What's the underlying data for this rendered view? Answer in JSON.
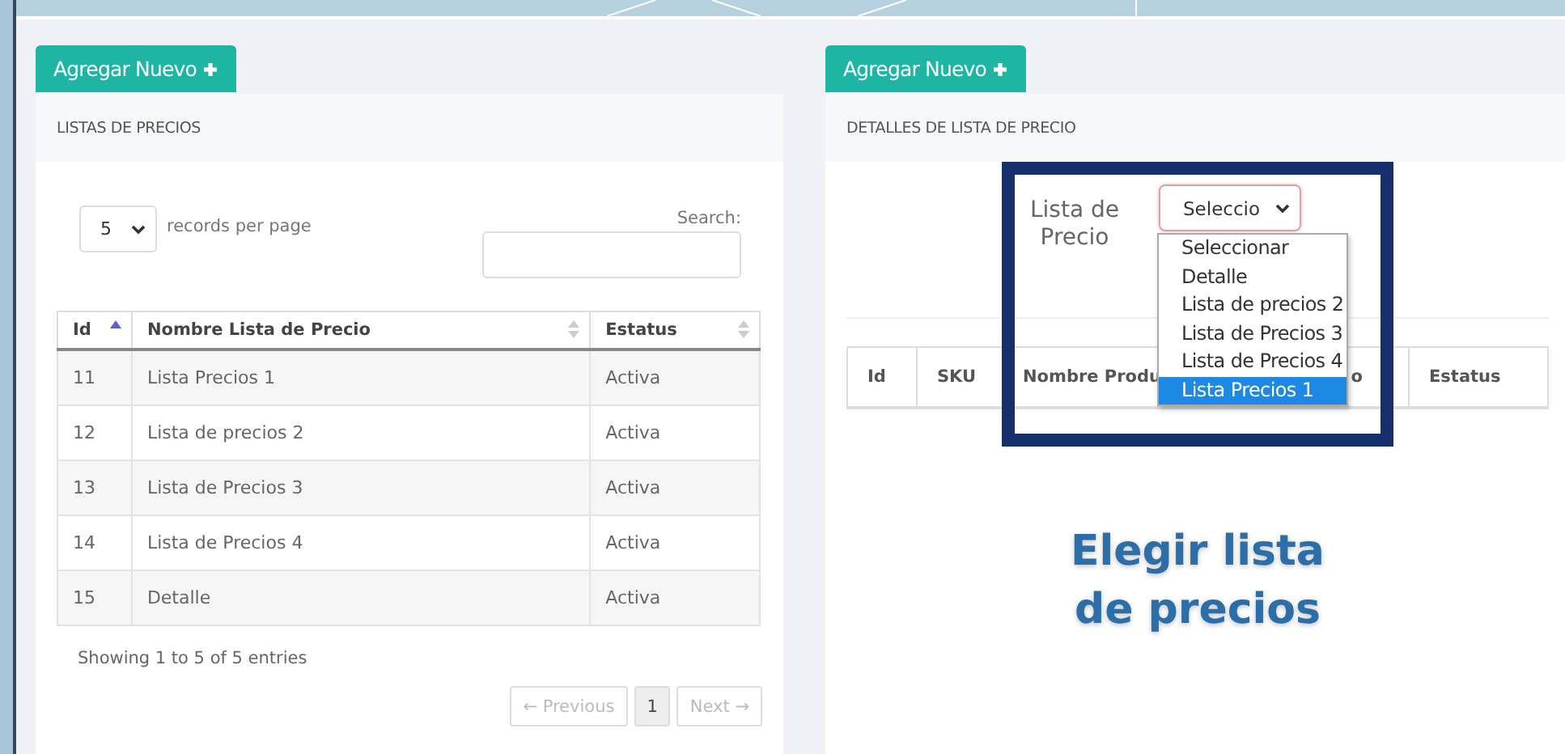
{
  "left_panel": {
    "add_button": "Agregar Nuevo",
    "title": "LISTAS DE PRECIOS",
    "page_size": "5",
    "page_size_label": "records per page",
    "search_label": "Search:",
    "columns": [
      {
        "label": "Id",
        "sorted": true
      },
      {
        "label": "Nombre Lista de Precio",
        "sorted": false
      },
      {
        "label": "Estatus",
        "sorted": false
      }
    ],
    "rows": [
      [
        "11",
        "Lista Precios 1",
        "Activa"
      ],
      [
        "12",
        "Lista de precios 2",
        "Activa"
      ],
      [
        "13",
        "Lista de Precios 3",
        "Activa"
      ],
      [
        "14",
        "Lista de Precios 4",
        "Activa"
      ],
      [
        "15",
        "Detalle",
        "Activa"
      ]
    ],
    "info": "Showing 1 to 5 of 5 entries",
    "pagination": [
      {
        "label": "← Previous",
        "selected": false,
        "disabled": true
      },
      {
        "label": "1",
        "selected": true,
        "disabled": false
      },
      {
        "label": "Next →",
        "selected": false,
        "disabled": true
      }
    ]
  },
  "right_panel": {
    "add_button": "Agregar Nuevo",
    "title": "DETALLES DE LISTA DE PRECIO",
    "filter_label": "Lista de Precio",
    "select_value": "Seleccio",
    "dropdown_options": [
      {
        "label": "Seleccionar",
        "selected": false
      },
      {
        "label": "Detalle",
        "selected": false
      },
      {
        "label": "Lista de precios 2",
        "selected": false
      },
      {
        "label": "Lista de Precios 3",
        "selected": false
      },
      {
        "label": "Lista de Precios 4",
        "selected": false
      },
      {
        "label": "Lista Precios 1",
        "selected": true
      }
    ],
    "columns": [
      "Id",
      "SKU",
      "Nombre Produ",
      "o",
      "Estatus"
    ]
  },
  "caption": "Elegir lista de precios"
}
